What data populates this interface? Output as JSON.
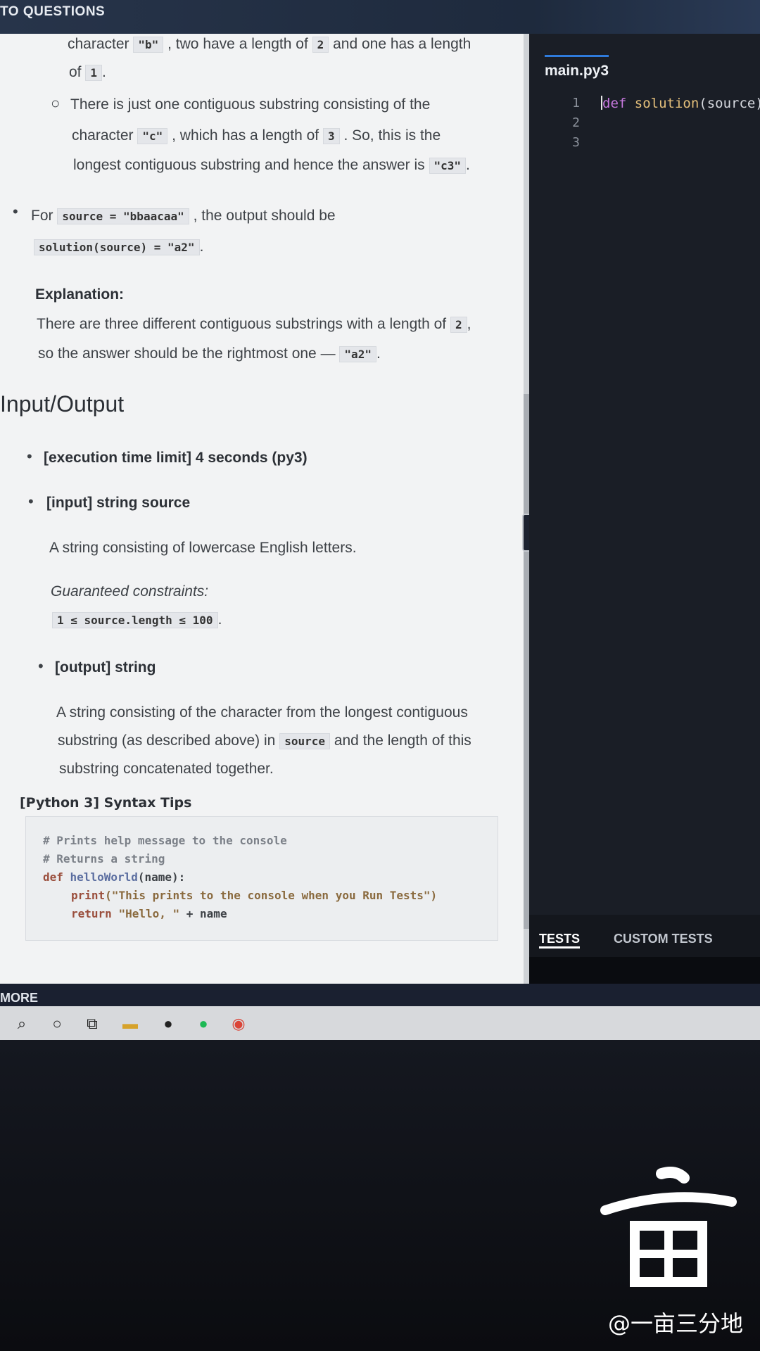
{
  "topbar": {
    "back_label": "TO QUESTIONS"
  },
  "problem": {
    "l1_a": "character",
    "l1_code": "\"b\"",
    "l1_b": ", two have a length of",
    "l1_num": "2",
    "l1_c": "and one has a length",
    "l2_a": "of",
    "l2_num": "1",
    "l2_b": ".",
    "b2_a": "There is just one contiguous substring consisting of the",
    "b2_b": "character",
    "b2_code": "\"c\"",
    "b2_c": ", which has a length of",
    "b2_num": "3",
    "b2_d": ". So, this is the",
    "b2_e": "longest contiguous substring and hence the answer is",
    "b2_ans": "\"c3\"",
    "b2_f": ".",
    "ex2_a": "For",
    "ex2_code": "source = \"bbaacaa\"",
    "ex2_b": ", the output should be",
    "ex2_out": "solution(source) = \"a2\"",
    "ex2_c": ".",
    "explanation_title": "Explanation:",
    "exp_a": "There are three different contiguous substrings with a length of",
    "exp_num": "2",
    "exp_b": ",",
    "exp_c": "so the answer should be the rightmost one —",
    "exp_ans": "\"a2\"",
    "exp_d": "."
  },
  "io": {
    "title": "Input/Output",
    "time_limit": "[execution time limit] 4 seconds (py3)",
    "input_label": "[input] string source",
    "input_desc": "A string consisting of lowercase English letters.",
    "constraints_label": "Guaranteed constraints:",
    "constraint": "1 ≤ source.length ≤ 100",
    "constraint_end": ".",
    "output_label": "[output] string",
    "out1": "A string consisting of the character from the longest contiguous",
    "out2_a": "substring (as described above) in",
    "out2_code": "source",
    "out2_b": "and the length of this",
    "out3": "substring concatenated together."
  },
  "tips": {
    "title": "[Python 3] Syntax Tips",
    "c1": "# Prints help message to the console",
    "c2": "# Returns a string",
    "c3_kw": "def",
    "c3_fn": "helloWorld",
    "c3_rest": "(name):",
    "c4_fn": "print",
    "c4_str": "(\"This prints to the console when you Run Tests\")",
    "c5_kw": "return",
    "c5_str": "\"Hello, \"",
    "c5_rest": " + name"
  },
  "editor": {
    "tab": "main.py3",
    "line_numbers": [
      "1",
      "2",
      "3"
    ],
    "code_kw": "def",
    "code_fn": "solution",
    "code_rest": "(source)"
  },
  "tests": {
    "tab1": "TESTS",
    "tab2": "CUSTOM TESTS"
  },
  "more_label": "MORE",
  "taskbar_icons": [
    "search-icon",
    "cortana-icon",
    "task-view-icon",
    "file-explorer-icon",
    "alienware-icon",
    "spotify-icon",
    "chrome-icon"
  ],
  "watermark": "@一亩三分地"
}
